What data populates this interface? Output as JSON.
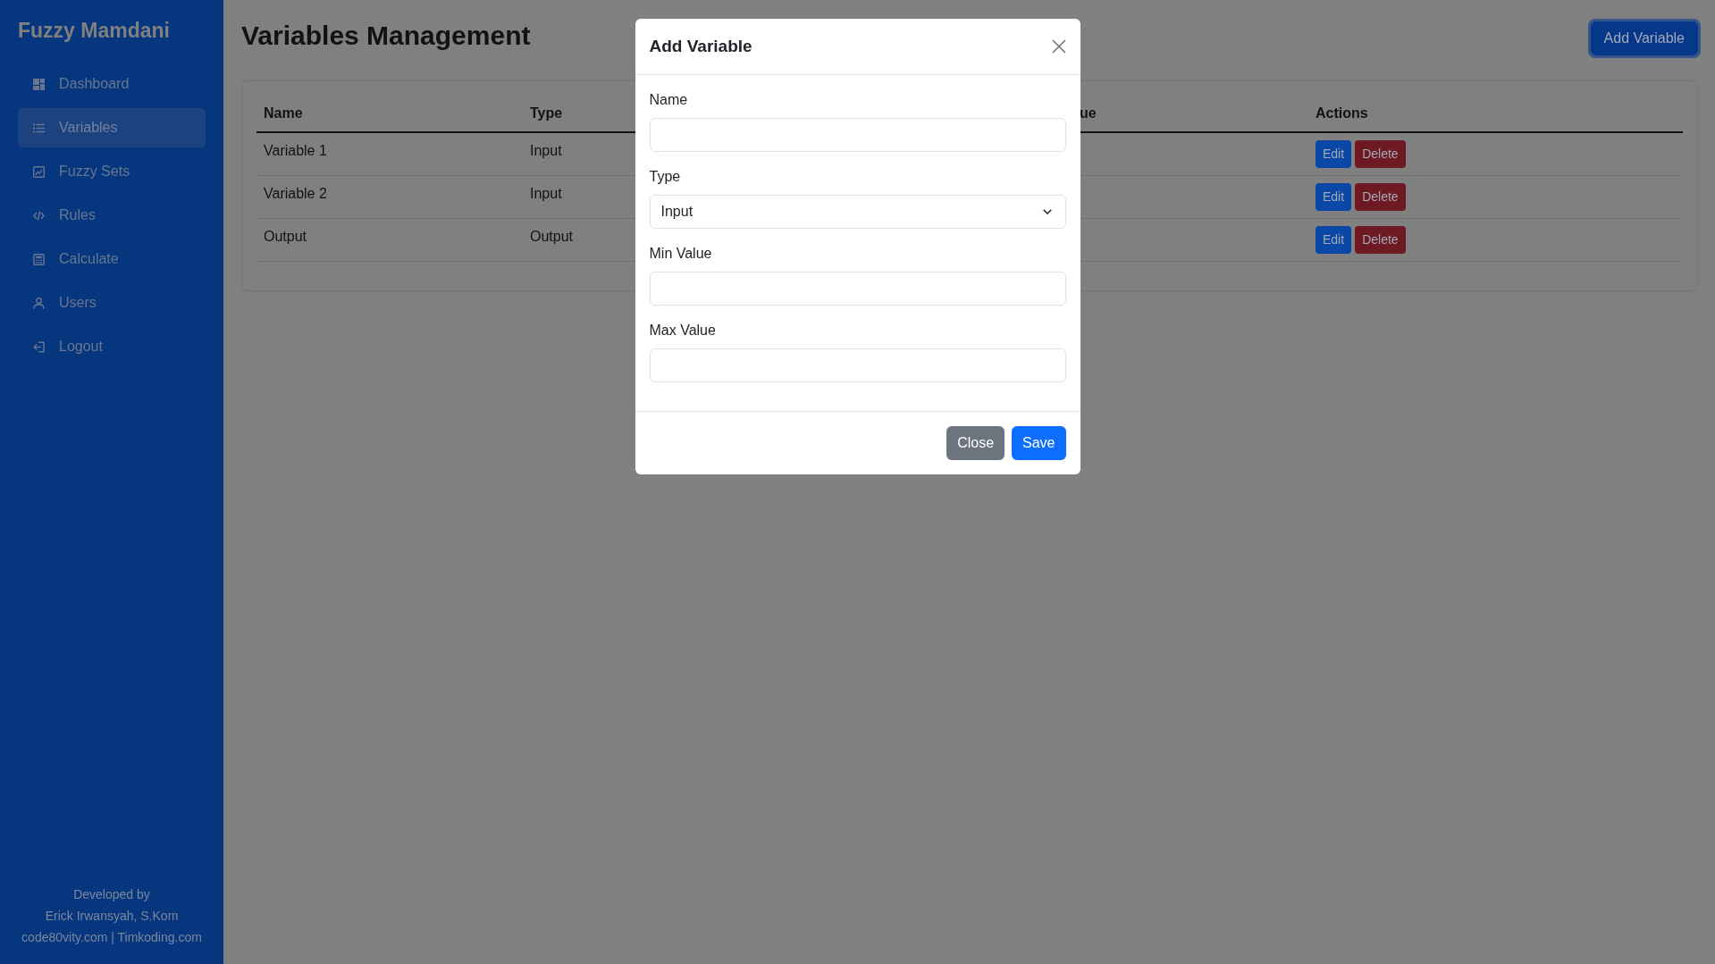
{
  "sidebar": {
    "title": "Fuzzy Mamdani",
    "items": [
      {
        "label": "Dashboard",
        "selected": false
      },
      {
        "label": "Variables",
        "selected": true
      },
      {
        "label": "Fuzzy Sets",
        "selected": false
      },
      {
        "label": "Rules",
        "selected": false
      },
      {
        "label": "Calculate",
        "selected": false
      },
      {
        "label": "Users",
        "selected": false
      },
      {
        "label": "Logout",
        "selected": false
      }
    ],
    "footer": [
      "Developed by",
      "Erick Irwansyah, S.Kom",
      "code80vity.com | Timkoding.com"
    ]
  },
  "header": {
    "title": "Variables Management",
    "add_button": {
      "label": "Add Variable",
      "focused": true
    }
  },
  "table": {
    "columns": [
      "Name",
      "Type",
      "ue",
      "Actions"
    ],
    "rows": [
      {
        "name": "Variable 1",
        "type": "Input",
        "actions": [
          {
            "label": "Edit",
            "kind": "primary"
          },
          {
            "label": "Delete",
            "kind": "danger"
          }
        ]
      },
      {
        "name": "Variable 2",
        "type": "Input",
        "actions": [
          {
            "label": "Edit",
            "kind": "primary"
          },
          {
            "label": "Delete",
            "kind": "danger"
          }
        ]
      },
      {
        "name": "Output",
        "type": "Output",
        "actions": [
          {
            "label": "Edit",
            "kind": "primary"
          },
          {
            "label": "Delete",
            "kind": "danger"
          }
        ]
      }
    ]
  },
  "modal": {
    "title": "Add Variable",
    "fields": [
      {
        "label": "Name",
        "kind": "text"
      },
      {
        "label": "Type",
        "kind": "select",
        "value": "Input"
      },
      {
        "label": "Min Value",
        "kind": "text"
      },
      {
        "label": "Max Value",
        "kind": "text"
      }
    ],
    "buttons": [
      {
        "label": "Close",
        "kind": "secondary"
      },
      {
        "label": "Save",
        "kind": "primary"
      }
    ]
  }
}
